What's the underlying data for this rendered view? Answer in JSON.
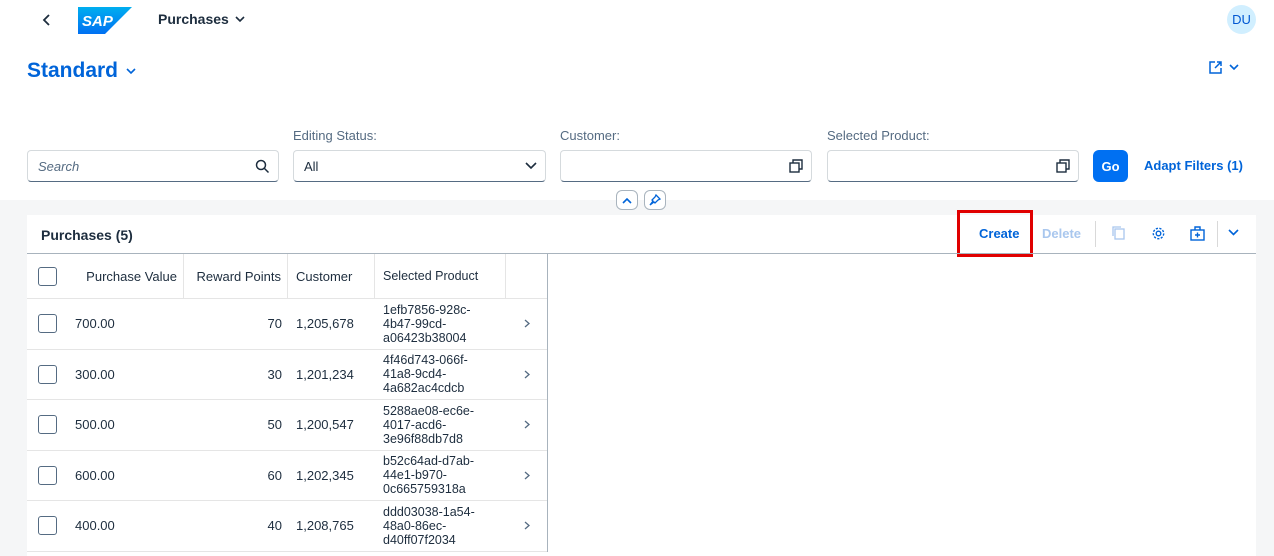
{
  "shell": {
    "title": "Purchases",
    "avatar_initials": "DU",
    "logo_text": "SAP",
    "brand_color": "#0070f2"
  },
  "header": {
    "variant_name": "Standard"
  },
  "filters": {
    "search": {
      "placeholder": "Search",
      "value": ""
    },
    "editing_status": {
      "label": "Editing Status:",
      "value": "All"
    },
    "customer": {
      "label": "Customer:",
      "value": ""
    },
    "selected_product": {
      "label": "Selected Product:",
      "value": ""
    },
    "go_label": "Go",
    "adapt_label": "Adapt Filters (1)"
  },
  "table": {
    "title": "Purchases (5)",
    "create_label": "Create",
    "delete_label": "Delete",
    "highlight_color": "#e00000",
    "columns": [
      "Purchase Value",
      "Reward Points",
      "Customer",
      "Selected Product"
    ],
    "rows": [
      {
        "purchase_value": "700.00",
        "reward_points": "70",
        "customer": "1,205,678",
        "selected_product": "1efb7856-928c-\n4b47-99cd-\na06423b38004"
      },
      {
        "purchase_value": "300.00",
        "reward_points": "30",
        "customer": "1,201,234",
        "selected_product": "4f46d743-066f-\n41a8-9cd4-\n4a682ac4cdcb"
      },
      {
        "purchase_value": "500.00",
        "reward_points": "50",
        "customer": "1,200,547",
        "selected_product": "5288ae08-ec6e-\n4017-acd6-\n3e96f88db7d8"
      },
      {
        "purchase_value": "600.00",
        "reward_points": "60",
        "customer": "1,202,345",
        "selected_product": "b52c64ad-d7ab-\n44e1-b970-\n0c665759318a"
      },
      {
        "purchase_value": "400.00",
        "reward_points": "40",
        "customer": "1,208,765",
        "selected_product": "ddd03038-1a54-\n48a0-86ec-\nd40ff07f2034"
      }
    ]
  }
}
